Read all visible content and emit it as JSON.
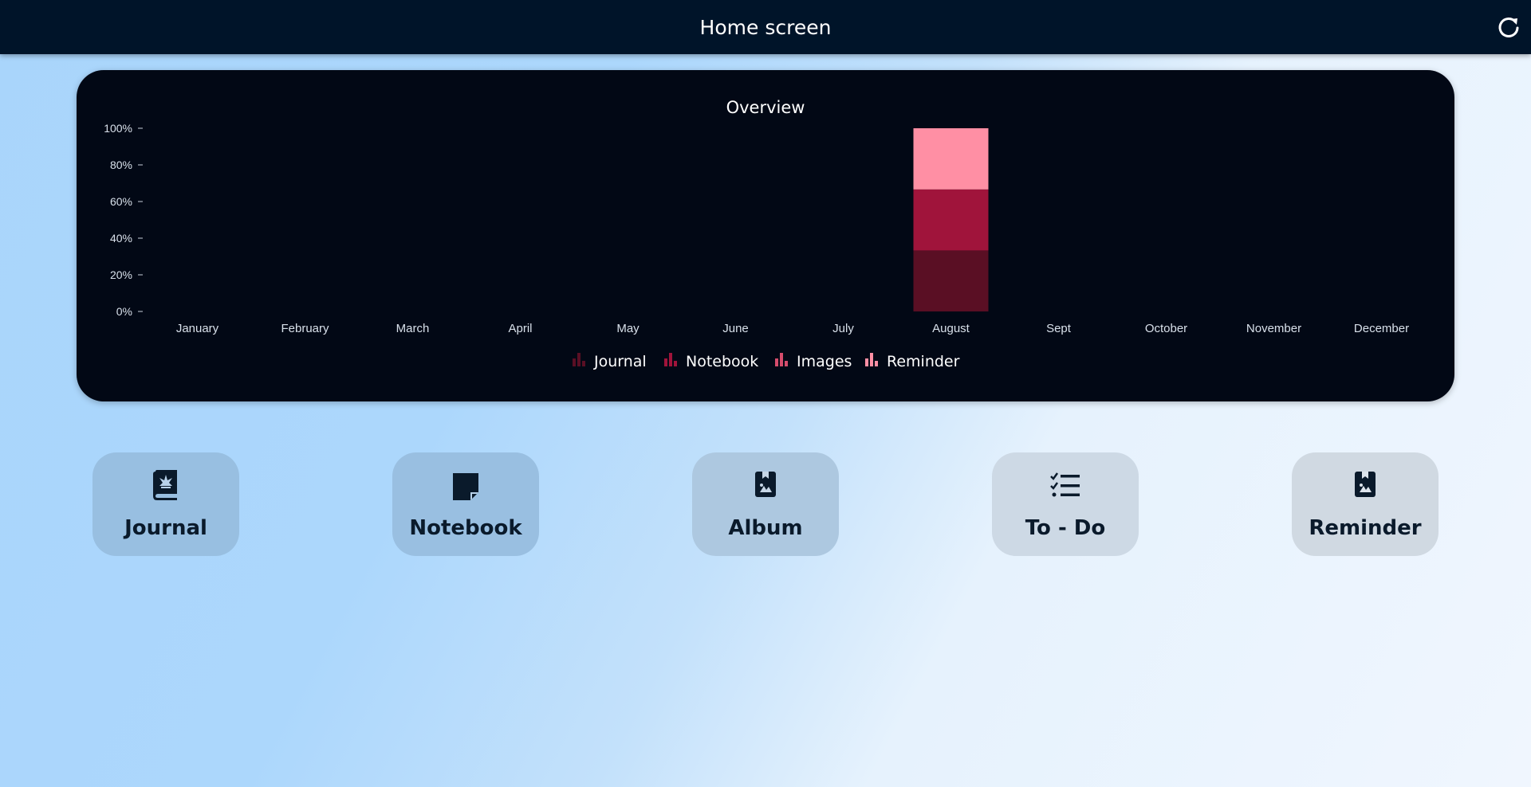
{
  "header": {
    "title": "Home screen",
    "refresh_icon": "refresh-icon"
  },
  "colors": {
    "topbar": "#001429",
    "panel": "#020815",
    "journal": "#5a0f24",
    "notebook": "#a0143b",
    "images": "#d64c6c",
    "reminder": "#ff8fa4"
  },
  "chart_data": {
    "type": "bar",
    "stacked": true,
    "title": "Overview",
    "categories": [
      "January",
      "February",
      "March",
      "April",
      "May",
      "June",
      "July",
      "August",
      "Sept",
      "October",
      "November",
      "December"
    ],
    "ytick_labels": [
      "0%",
      "20%",
      "40%",
      "60%",
      "80%",
      "100%"
    ],
    "ylim": [
      0,
      100
    ],
    "grid": false,
    "legend_position": "bottom-center",
    "series": [
      {
        "name": "Journal",
        "color": "#5a0f24",
        "values": [
          0,
          0,
          0,
          0,
          0,
          0,
          0,
          33.3,
          0,
          0,
          0,
          0
        ]
      },
      {
        "name": "Notebook",
        "color": "#a0143b",
        "values": [
          0,
          0,
          0,
          0,
          0,
          0,
          0,
          33.3,
          0,
          0,
          0,
          0
        ]
      },
      {
        "name": "Images",
        "color": "#d64c6c",
        "values": [
          0,
          0,
          0,
          0,
          0,
          0,
          0,
          0,
          0,
          0,
          0,
          0
        ]
      },
      {
        "name": "Reminder",
        "color": "#ff8fa4",
        "values": [
          0,
          0,
          0,
          0,
          0,
          0,
          0,
          33.4,
          0,
          0,
          0,
          0
        ]
      }
    ]
  },
  "cards": [
    {
      "label": "Journal",
      "icon": "journal-book-icon",
      "bg": "#98bfe1"
    },
    {
      "label": "Notebook",
      "icon": "sticky-note-icon",
      "bg": "#99bfe1"
    },
    {
      "label": "Album",
      "icon": "photo-book-icon",
      "bg": "#adc8e0"
    },
    {
      "label": "To - Do",
      "icon": "checklist-icon",
      "bg": "#cdd9e5"
    },
    {
      "label": "Reminder",
      "icon": "photo-book-icon",
      "bg": "#d0d9e2"
    }
  ]
}
